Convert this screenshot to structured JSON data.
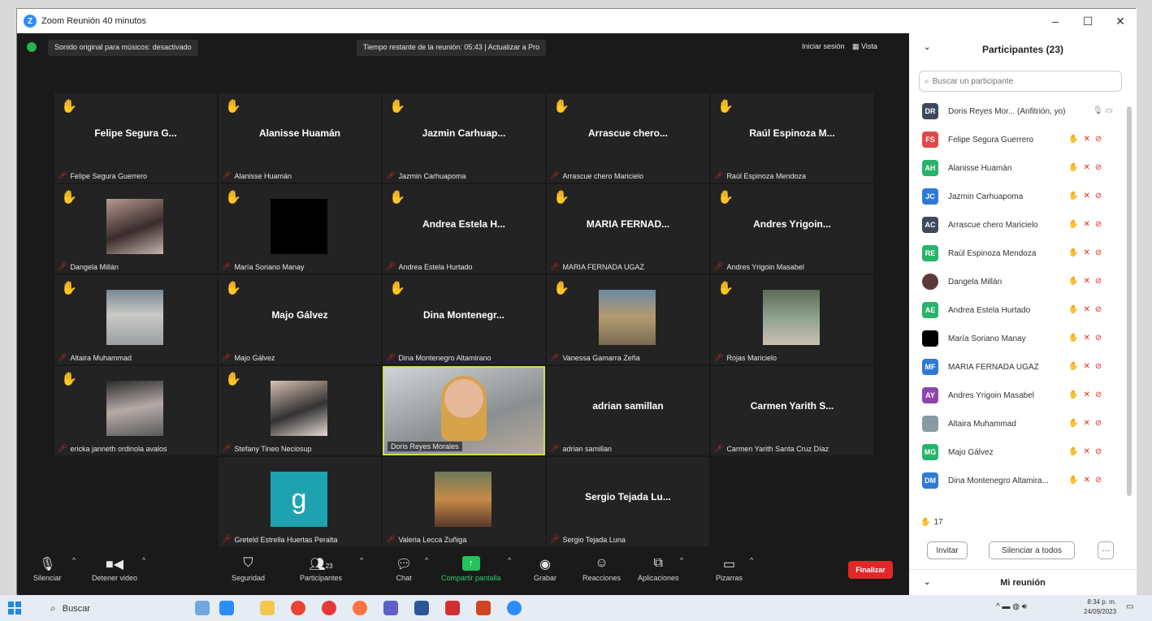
{
  "window": {
    "title": "Zoom Reunión 40 minutos",
    "minimize": "–",
    "maximize": "☐",
    "close": "✕"
  },
  "topbar": {
    "sound": "Sonido original para músicos: desactivado",
    "timer": "Tiempo restante de la reunión: 05:43 | Actualizar a Pro",
    "signin": "Iniciar sesión",
    "view": "Vista"
  },
  "tiles": [
    {
      "big": "Felipe Segura G...",
      "name": "Felipe Segura Guerrero",
      "hand": "yellow"
    },
    {
      "big": "Alanisse Huamán",
      "name": "Alanisse Huamán",
      "hand": "yellow"
    },
    {
      "big": "Jazmin Carhuap...",
      "name": "Jazmin Carhuapoma",
      "hand": "yellow"
    },
    {
      "big": "Arrascue chero...",
      "name": "Arrascue chero Maricielo",
      "hand": "light"
    },
    {
      "big": "Raúl Espinoza M...",
      "name": "Raúl Espinoza Mendoza",
      "hand": "light"
    },
    {
      "big": "",
      "name": "Dangela Millán",
      "hand": "yellow"
    },
    {
      "big": "",
      "name": "María Soriano Manay",
      "hand": "yellow"
    },
    {
      "big": "Andrea Estela H...",
      "name": "Andrea Estela Hurtado",
      "hand": "yellow"
    },
    {
      "big": "MARIA FERNAD...",
      "name": "MARIA FERNADA UGAZ",
      "hand": "yellow"
    },
    {
      "big": "Andres Yrigoin...",
      "name": "Andres Yrigoin Masabel",
      "hand": "yellow"
    },
    {
      "big": "",
      "name": "Altaira Muhammad",
      "hand": "yellow"
    },
    {
      "big": "Majo Gálvez",
      "name": "Majo Gálvez",
      "hand": "yellow"
    },
    {
      "big": "Dina Montenegr...",
      "name": "Dina Montenegro Altamirano",
      "hand": "yellow"
    },
    {
      "big": "",
      "name": "Vanessa Gamarra Zeña",
      "hand": "light"
    },
    {
      "big": "",
      "name": "Rojas Maricielo",
      "hand": "yellow"
    },
    {
      "big": "",
      "name": "ericka janneth ordinola avalos",
      "hand": "yellow"
    },
    {
      "big": "",
      "name": "Stefany Tineo Neciosup",
      "hand": "yellow"
    },
    {
      "big": "",
      "name": "Doris Reyes Morales",
      "hand": ""
    },
    {
      "big": "adrian samillan",
      "name": "adrian samillan",
      "hand": ""
    },
    {
      "big": "Carmen Yarith S...",
      "name": "Carmen Yarith Santa Cruz Díaz",
      "hand": ""
    },
    {
      "big": "g",
      "name": "Greteld Estrella Huertas Peralta",
      "hand": ""
    },
    {
      "big": "",
      "name": "Valeria Lecca Zuñiga",
      "hand": ""
    },
    {
      "big": "Sergio Tejada Lu...",
      "name": "Sergio Tejada Luna",
      "hand": ""
    }
  ],
  "toolbar": {
    "mute": "Silenciar",
    "video": "Detener video",
    "security": "Seguridad",
    "participants": "Participantes",
    "participants_count": "23",
    "chat": "Chat",
    "share": "Compartir pantalla",
    "record": "Grabar",
    "reactions": "Reacciones",
    "apps": "Aplicaciones",
    "whiteboards": "Pizarras",
    "end": "Finalizar"
  },
  "panel": {
    "title": "Participantes (23)",
    "search_placeholder": "Buscar un participante",
    "participants": [
      {
        "initials": "DR",
        "color": "#3d4a5c",
        "name": "Doris Reyes Mor... (Anfitrión, yo)"
      },
      {
        "initials": "FS",
        "color": "#e04848",
        "name": "Felipe Segura Guerrero"
      },
      {
        "initials": "AH",
        "color": "#27b36a",
        "name": "Alanisse Huamán"
      },
      {
        "initials": "JC",
        "color": "#2f79d6",
        "name": "Jazmin Carhuapoma"
      },
      {
        "initials": "AC",
        "color": "#3d4a5c",
        "name": "Arrascue chero Maricielo"
      },
      {
        "initials": "RE",
        "color": "#27b36a",
        "name": "Raúl Espinoza Mendoza"
      },
      {
        "initials": "",
        "color": "#5a3a3a",
        "name": "Dangela Millán"
      },
      {
        "initials": "AE",
        "color": "#27b36a",
        "name": "Andrea Estela Hurtado"
      },
      {
        "initials": "",
        "color": "#000000",
        "name": "María Soriano Manay"
      },
      {
        "initials": "MF",
        "color": "#2f79d6",
        "name": "MARIA FERNADA UGAZ"
      },
      {
        "initials": "AY",
        "color": "#8e44ad",
        "name": "Andres Yrigoin Masabel"
      },
      {
        "initials": "",
        "color": "#8a9aa5",
        "name": "Altaira Muhammad"
      },
      {
        "initials": "MG",
        "color": "#27b36a",
        "name": "Majo Gálvez"
      },
      {
        "initials": "DM",
        "color": "#2f79d6",
        "name": "Dina Montenegro Altamira..."
      }
    ],
    "hand_count": "17",
    "invite": "Invitar",
    "mute_all": "Silenciar a todos",
    "more": "···",
    "my_meeting": "Mi reunión"
  },
  "taskbar": {
    "search": "Buscar",
    "time": "8:34 p. m.",
    "date": "24/09/2023"
  }
}
